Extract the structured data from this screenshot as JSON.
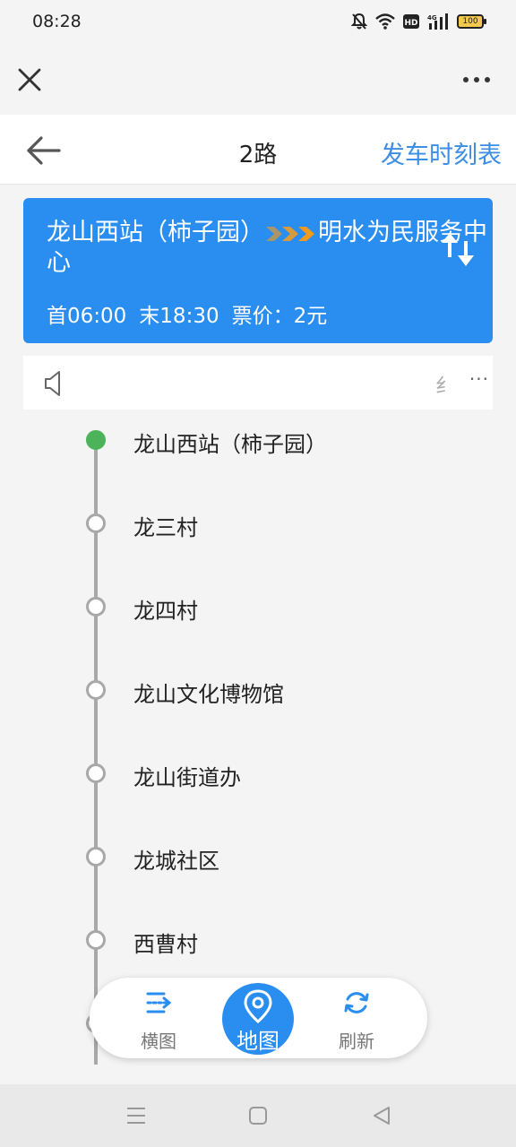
{
  "status": {
    "time": "08:28",
    "battery": "100",
    "icons": [
      "mute-bell-icon",
      "wifi-icon",
      "hd-icon",
      "4g-signal-icon",
      "battery-icon"
    ]
  },
  "browser": {
    "close_icon": "close-icon",
    "more_icon": "more-dots-icon"
  },
  "header": {
    "title": "2路",
    "schedule_link": "发车时刻表"
  },
  "route": {
    "from": "龙山西站（柿子园）",
    "to": "明水为民服务中心",
    "first_bus": "首06:00",
    "last_bus": "末18:30",
    "fare": "票价：2元",
    "arrow_colors": [
      "#a9956a",
      "#d89a3a",
      "#f29a1d"
    ]
  },
  "notice": {
    "text": "纟",
    "more": "···"
  },
  "stops": [
    {
      "name": "龙山西站（柿子园）",
      "current": true
    },
    {
      "name": "龙三村",
      "current": false
    },
    {
      "name": "龙四村",
      "current": false
    },
    {
      "name": "龙山文化博物馆",
      "current": false
    },
    {
      "name": "龙山街道办",
      "current": false
    },
    {
      "name": "龙城社区",
      "current": false
    },
    {
      "name": "西曹村",
      "current": false
    },
    {
      "name": "",
      "current": false
    }
  ],
  "floating_bar": {
    "horizontal_label": "横图",
    "map_label": "地图",
    "refresh_label": "刷新"
  },
  "colors": {
    "accent": "#2a8ef0",
    "link": "#3a8ee6",
    "current_stop": "#4cb35a",
    "line_gray": "#a8a8a8"
  }
}
